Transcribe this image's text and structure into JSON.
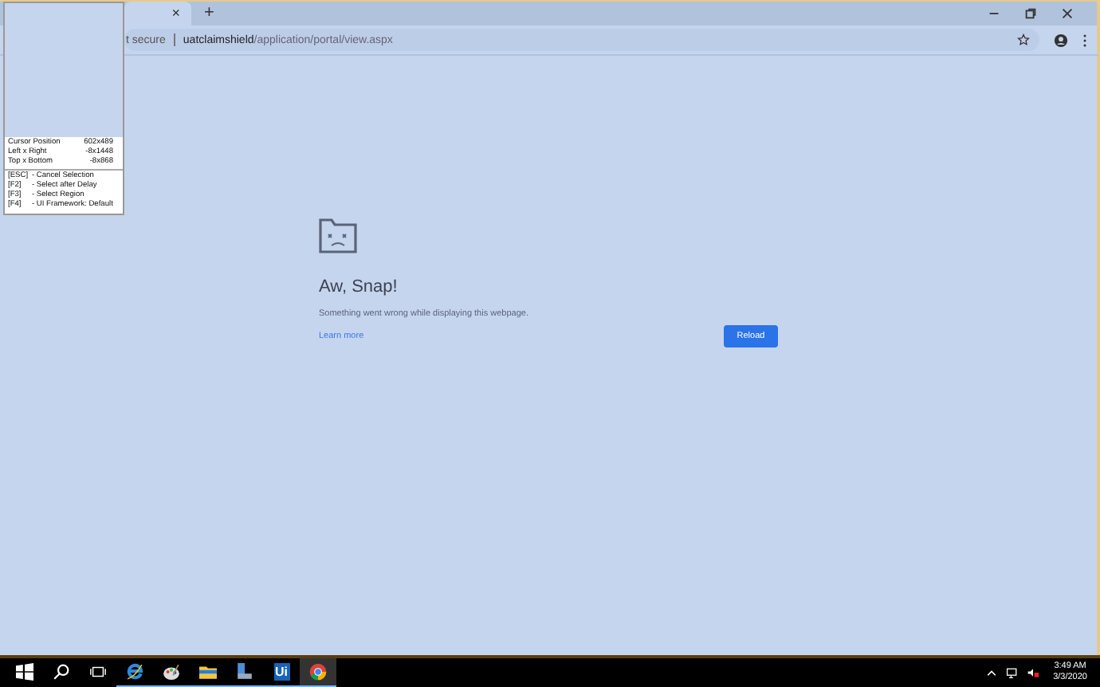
{
  "browser": {
    "tab": {
      "close": "×"
    },
    "new_tab": "+",
    "address": {
      "security": "t secure",
      "host": "uatclaimshield",
      "path": "/application/portal/view.aspx"
    }
  },
  "error_page": {
    "title": "Aw, Snap!",
    "message": "Something went wrong while displaying this webpage.",
    "link": "Learn more",
    "button": "Reload"
  },
  "capture_overlay": {
    "rows": [
      {
        "label": "Cursor Position",
        "value": "602x489"
      },
      {
        "label": "Left x Right",
        "value": "-8x1448"
      },
      {
        "label": "Top x Bottom",
        "value": "-8x868"
      }
    ],
    "keys": [
      {
        "key": "[ESC]",
        "action": "- Cancel Selection"
      },
      {
        "key": "[F2]",
        "action": "- Select after Delay"
      },
      {
        "key": "[F3]",
        "action": "- Select Region"
      },
      {
        "key": "[F4]",
        "action": "- UI Framework: Default"
      }
    ]
  },
  "taskbar": {
    "items": [
      {
        "kind": "start",
        "running": false,
        "active": false
      },
      {
        "kind": "search",
        "running": false,
        "active": false
      },
      {
        "kind": "taskview",
        "running": false,
        "active": false
      },
      {
        "kind": "ie",
        "running": true,
        "active": false
      },
      {
        "kind": "paint",
        "running": true,
        "active": false
      },
      {
        "kind": "folder",
        "running": true,
        "active": false
      },
      {
        "kind": "app",
        "running": true,
        "active": false
      },
      {
        "kind": "ui",
        "label": "Ui",
        "running": true,
        "active": false
      },
      {
        "kind": "chrome",
        "running": true,
        "active": true
      }
    ],
    "time": "3:49 AM",
    "date": "3/3/2020"
  }
}
